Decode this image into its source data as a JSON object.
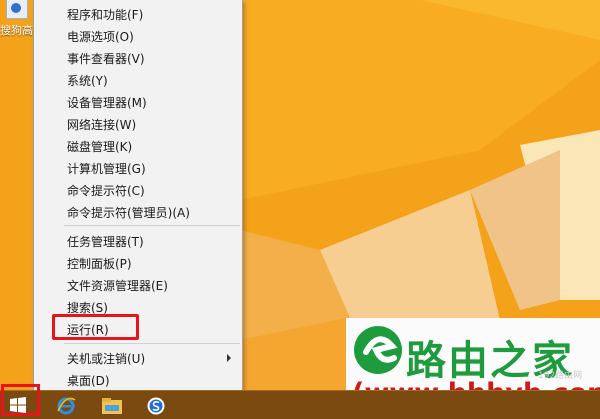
{
  "desktop": {
    "icon_label": "搜狗高"
  },
  "menu": {
    "group1": [
      {
        "label": "程序和功能(F)"
      },
      {
        "label": "电源选项(O)"
      },
      {
        "label": "事件查看器(V)"
      },
      {
        "label": "系统(Y)"
      },
      {
        "label": "设备管理器(M)"
      },
      {
        "label": "网络连接(W)"
      },
      {
        "label": "磁盘管理(K)"
      },
      {
        "label": "计算机管理(G)"
      },
      {
        "label": "命令提示符(C)"
      },
      {
        "label": "命令提示符(管理员)(A)"
      }
    ],
    "group2": [
      {
        "label": "任务管理器(T)"
      },
      {
        "label": "控制面板(P)"
      },
      {
        "label": "文件资源管理器(E)"
      },
      {
        "label": "搜索(S)"
      },
      {
        "label": "运行(R)"
      }
    ],
    "group3": [
      {
        "label": "关机或注销(U)"
      },
      {
        "label": "桌面(D)"
      }
    ]
  },
  "watermark": {
    "name": "路由之家",
    "url": "(www.hhhyh.com)",
    "small": "192路由网"
  },
  "colors": {
    "desktop_orange": "#f4a21a",
    "highlight_red": "#e8141b",
    "brand_green": "#1e9b3c",
    "brand_red": "#d01a1a"
  },
  "icons": {
    "start": "windows-logo-icon",
    "ie": "internet-explorer-icon",
    "explorer": "file-explorer-icon",
    "app": "sogou-browser-icon"
  }
}
